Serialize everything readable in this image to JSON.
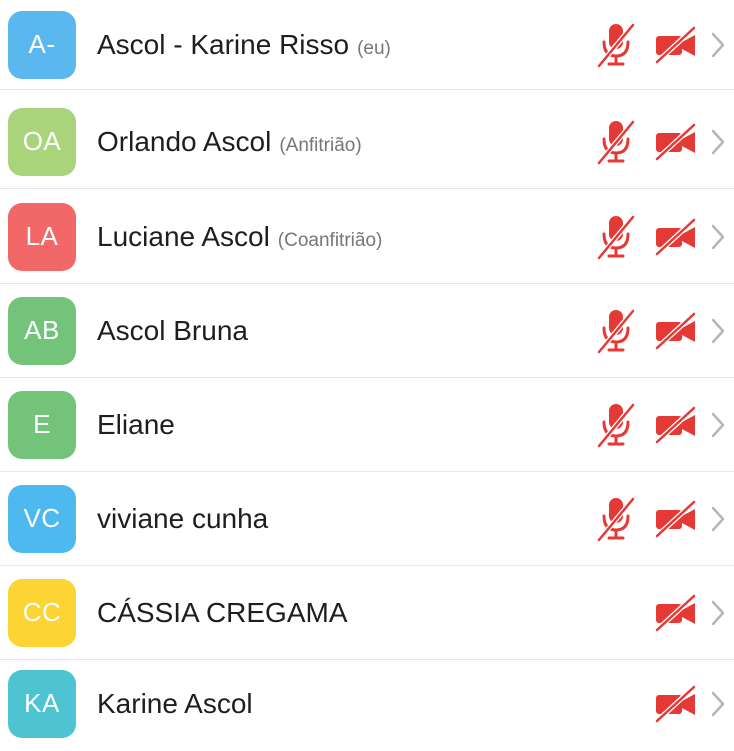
{
  "participants": [
    {
      "initials": "A-",
      "name": "Ascol - Karine Risso",
      "role": "(eu)",
      "color": "#5AB8EE",
      "mic_muted": true,
      "mic_visible": true,
      "camera_off": true
    },
    {
      "initials": "OA",
      "name": "Orlando Ascol",
      "role": "(Anfitrião)",
      "color": "#A9D47B",
      "mic_muted": true,
      "mic_visible": true,
      "camera_off": true
    },
    {
      "initials": "LA",
      "name": "Luciane Ascol",
      "role": "(Coanfitrião)",
      "color": "#F26868",
      "mic_muted": true,
      "mic_visible": true,
      "camera_off": true
    },
    {
      "initials": "AB",
      "name": "Ascol Bruna",
      "role": "",
      "color": "#73C47A",
      "mic_muted": true,
      "mic_visible": true,
      "camera_off": true
    },
    {
      "initials": "E",
      "name": "Eliane",
      "role": "",
      "color": "#73C47A",
      "mic_muted": true,
      "mic_visible": true,
      "camera_off": true
    },
    {
      "initials": "VC",
      "name": "viviane cunha",
      "role": "",
      "color": "#4DB9EE",
      "mic_muted": true,
      "mic_visible": true,
      "camera_off": true
    },
    {
      "initials": "CC",
      "name": "CÁSSIA CREGAMA",
      "role": "",
      "color": "#FCD535",
      "mic_muted": false,
      "mic_visible": false,
      "camera_off": true
    },
    {
      "initials": "KA",
      "name": "Karine Ascol",
      "role": "",
      "color": "#4EC3D1",
      "mic_muted": false,
      "mic_visible": false,
      "camera_off": true
    }
  ],
  "icons": {
    "mic": "mic-muted-icon",
    "camera": "video-off-icon",
    "chevron": "chevron-right-icon"
  },
  "colors": {
    "muted_red": "#E53935",
    "chevron_gray": "#B5B5B5",
    "divider": "#E9E9E9"
  }
}
